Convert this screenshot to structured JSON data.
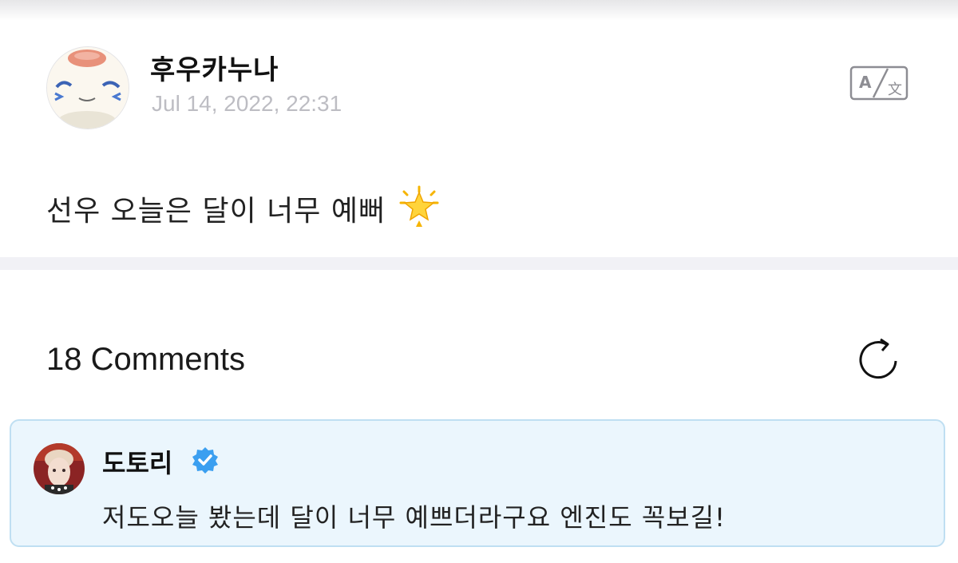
{
  "post": {
    "author": "후우카누나",
    "timestamp": "Jul 14, 2022, 22:31",
    "body": "선우 오늘은 달이 너무 예뻐",
    "emoji_icon": "glowing-star-icon",
    "translate_icon": "translate-icon"
  },
  "comments": {
    "title": "18 Comments",
    "refresh_icon": "refresh-icon",
    "items": [
      {
        "author": "도토리",
        "verified": true,
        "text": "저도오늘 봤는데 달이 너무 예쁘더라구요 엔진도 꼭보길!"
      }
    ]
  },
  "colors": {
    "comment_highlight_bg": "#ebf6fd",
    "comment_highlight_border": "#bfdff2",
    "verified_badge": "#3b9ff0",
    "timestamp_gray": "#bdbdc3"
  }
}
